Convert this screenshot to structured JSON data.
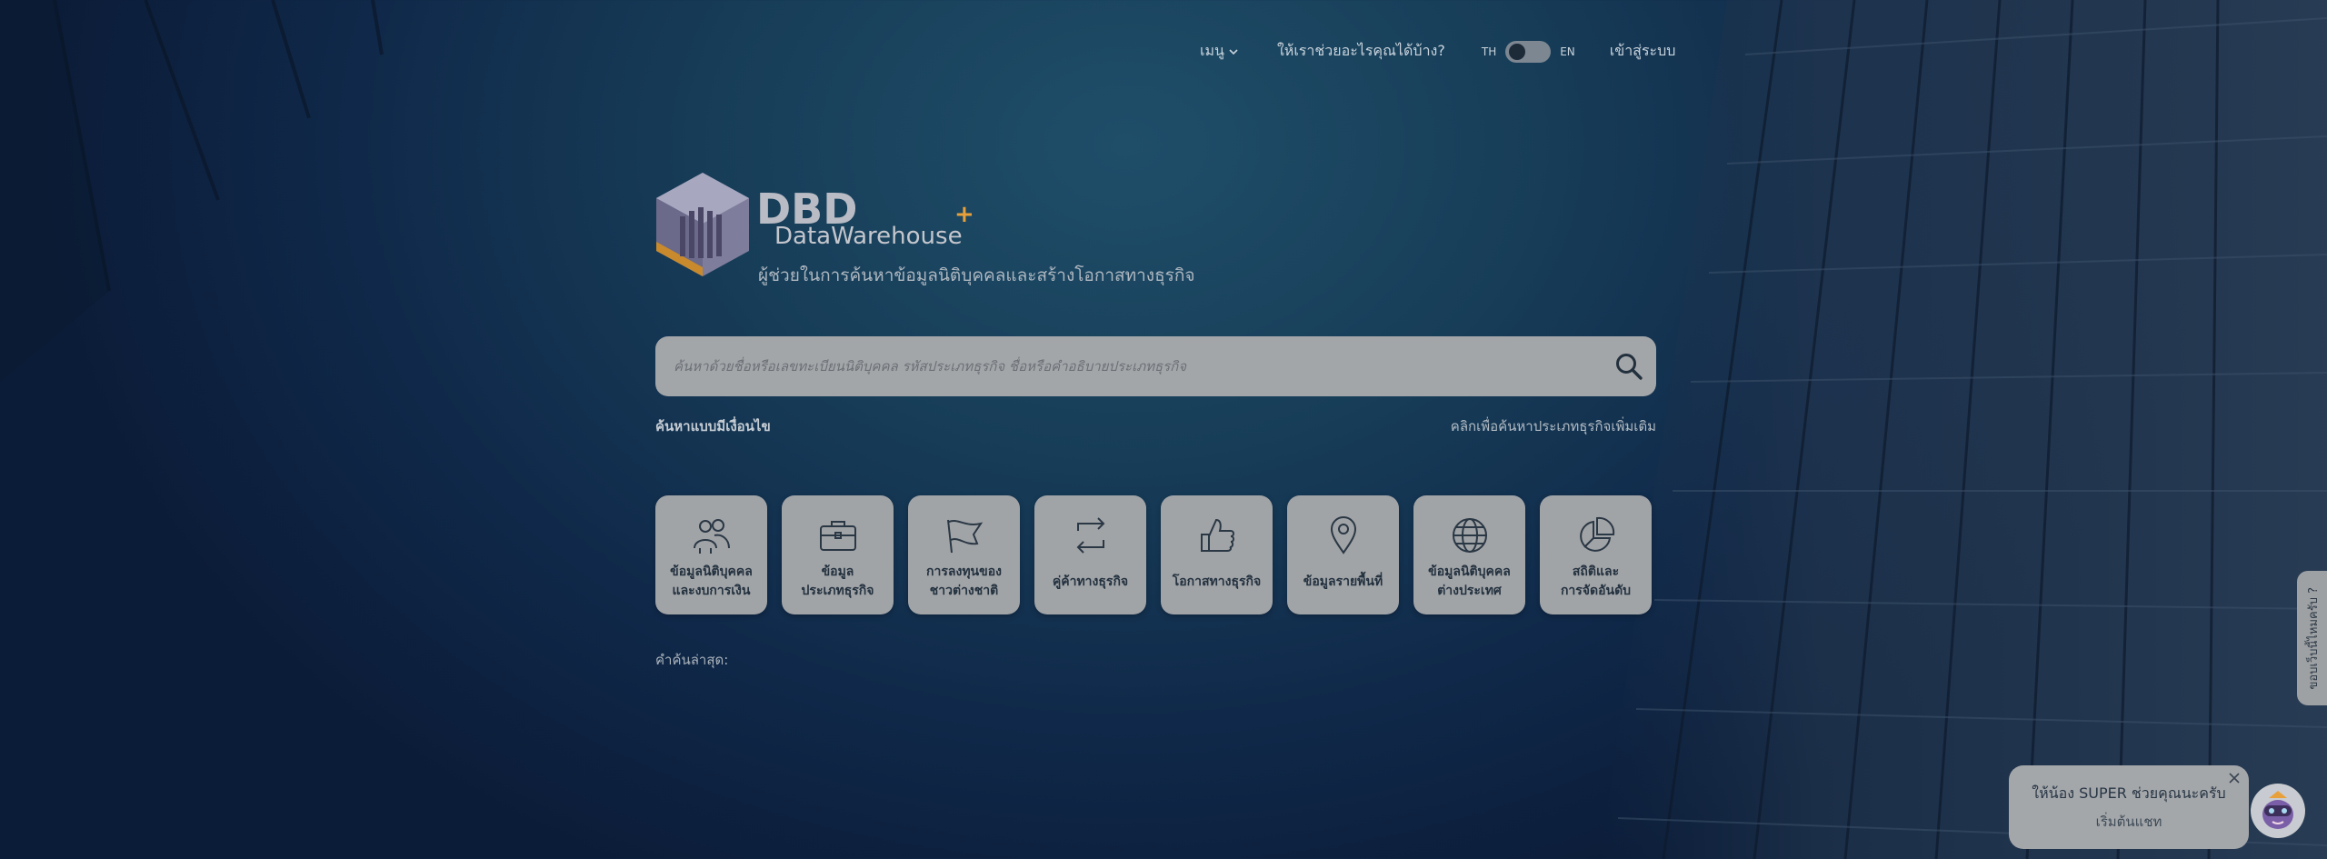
{
  "topnav": {
    "menu_label": "เมนู",
    "help_label": "ให้เราช่วยอะไรคุณได้บ้าง?",
    "lang_th": "TH",
    "lang_en": "EN",
    "login_label": "เข้าสู่ระบบ"
  },
  "brand": {
    "logo_letters": "DBD",
    "logo_word": "DataWarehouse",
    "logo_plus": "+",
    "tagline": "ผู้ช่วยในการค้นหาข้อมูลนิติบุคคลและสร้างโอกาสทางธุรกิจ",
    "accent": "#e8a13a"
  },
  "search": {
    "placeholder": "ค้นหาด้วยชื่อหรือเลขทะเบียนนิติบุคคล รหัสประเภทธุรกิจ ชื่อหรือคำอธิบายประเภทธุรกิจ",
    "value": "",
    "advanced_label": "ค้นหาแบบมีเงื่อนไข",
    "more_label": "คลิกเพื่อค้นหาประเภทธุรกิจเพิ่มเติม"
  },
  "categories": [
    {
      "icon": "people-icon",
      "line1": "ข้อมูลนิติบุคคล",
      "line2": "และงบการเงิน"
    },
    {
      "icon": "briefcase-icon",
      "line1": "ข้อมูล",
      "line2": "ประเภทธุรกิจ"
    },
    {
      "icon": "flag-icon",
      "line1": "การลงทุนของ",
      "line2": "ชาวต่างชาติ"
    },
    {
      "icon": "exchange-icon",
      "line1": "คู่ค้าทางธุรกิจ",
      "line2": ""
    },
    {
      "icon": "thumbs-up-icon",
      "line1": "โอกาสทางธุรกิจ",
      "line2": ""
    },
    {
      "icon": "map-pin-icon",
      "line1": "ข้อมูลรายพื้นที่",
      "line2": ""
    },
    {
      "icon": "globe-icon",
      "line1": "ข้อมูลนิติบุคคล",
      "line2": "ต่างประเทศ"
    },
    {
      "icon": "pie-chart-icon",
      "line1": "สถิติและ",
      "line2": "การจัดอันดับ"
    }
  ],
  "recent_label": "คำค้นล่าสุด:",
  "feedback_tab": "ขอบเว็บนี้ไหมครับ ?",
  "chat": {
    "line1": "ให้น้อง SUPER ช่วยคุณนะครับ",
    "line2": "เริ่มต้นแชท"
  }
}
